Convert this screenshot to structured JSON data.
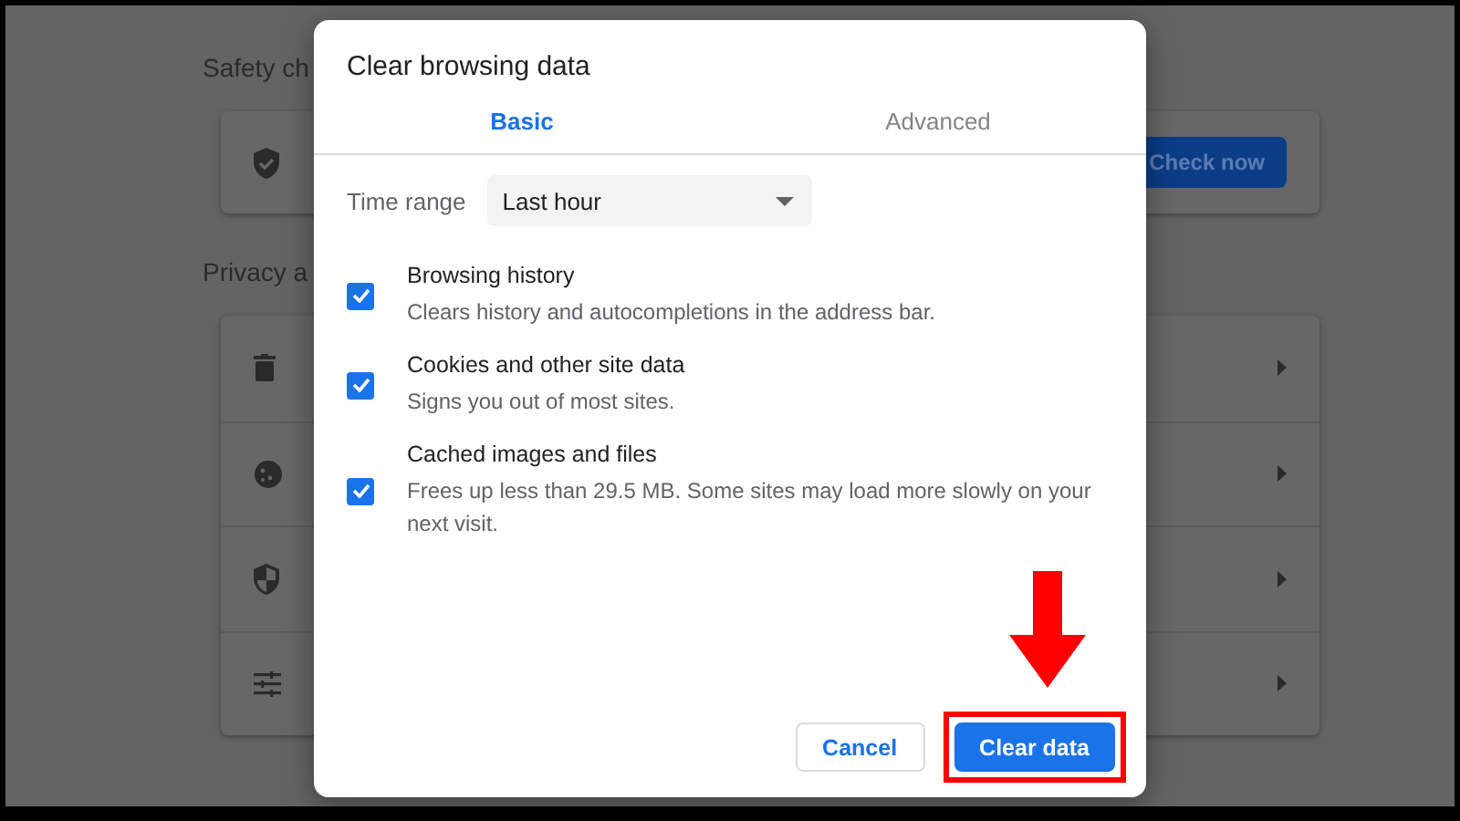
{
  "background": {
    "safety_heading": "Safety ch",
    "safety_card": {
      "button": "Check now"
    },
    "privacy_heading": "Privacy a",
    "privacy_rows": [
      {
        "kind": "trash"
      },
      {
        "kind": "cookie"
      },
      {
        "kind": "shield"
      },
      {
        "kind": "sliders"
      }
    ]
  },
  "dialog": {
    "title": "Clear browsing data",
    "tabs": [
      {
        "label": "Basic",
        "selected": true
      },
      {
        "label": "Advanced",
        "selected": false
      }
    ],
    "time_range": {
      "label": "Time range",
      "value": "Last hour"
    },
    "items": [
      {
        "title": "Browsing history",
        "description": "Clears history and autocompletions in the address bar.",
        "checked": true
      },
      {
        "title": "Cookies and other site data",
        "description": "Signs you out of most sites.",
        "checked": true
      },
      {
        "title": "Cached images and files",
        "description": "Frees up less than 29.5 MB. Some sites may load more slowly on your next visit.",
        "checked": true
      }
    ],
    "buttons": [
      {
        "label": "Cancel",
        "kind": "secondary",
        "highlighted": false
      },
      {
        "label": "Clear data",
        "kind": "primary",
        "highlighted": true
      }
    ]
  }
}
